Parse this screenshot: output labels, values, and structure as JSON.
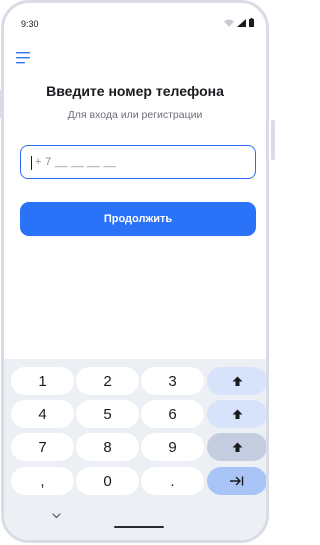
{
  "status": {
    "time": "9:30",
    "icons": [
      "wifi-icon",
      "signal-icon",
      "battery-icon"
    ]
  },
  "header": {
    "menu_icon": "hamburger-menu-icon"
  },
  "main": {
    "title": "Введите номер телефона",
    "subtitle": "Для входа или регистрации",
    "phone_field": {
      "value": "+ 7 __ __ __ __"
    },
    "continue_label": "Продолжить"
  },
  "keyboard": {
    "rows": [
      [
        "1",
        "2",
        "3"
      ],
      [
        "4",
        "5",
        "6"
      ],
      [
        "7",
        "8",
        "9"
      ],
      [
        ",",
        "0",
        "."
      ]
    ],
    "collapse_icon": "chevron-down-icon",
    "side_keys": [
      "shift-icon",
      "shift-icon",
      "shift-icon",
      "tab-icon"
    ]
  },
  "colors": {
    "accent": "#2a72f8",
    "input_border": "#2f6cf6",
    "keyboard_bg": "#eceff4",
    "action_key": "#d7e2fb",
    "enter_key": "#a9c4f7"
  }
}
